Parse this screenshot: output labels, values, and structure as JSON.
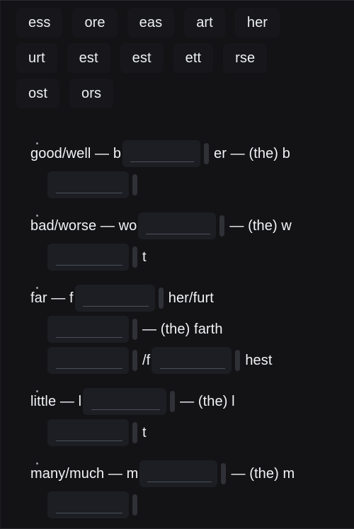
{
  "word_bank": {
    "rows": [
      [
        {
          "label": "ess"
        },
        {
          "label": "ore"
        },
        {
          "label": "eas"
        },
        {
          "label": "art"
        },
        {
          "label": "her"
        }
      ],
      [
        {
          "label": "urt"
        },
        {
          "label": "est"
        },
        {
          "label": "est"
        },
        {
          "label": "ett"
        },
        {
          "label": "rse"
        }
      ],
      [
        {
          "label": "ost"
        },
        {
          "label": "ors"
        }
      ]
    ]
  },
  "exercises": [
    {
      "lines": [
        {
          "indent": false,
          "parts": [
            {
              "kind": "text",
              "value": "good/well — b"
            },
            {
              "kind": "blank",
              "width": 110
            },
            {
              "kind": "caret"
            },
            {
              "kind": "text",
              "value": "er — (the) b"
            }
          ]
        },
        {
          "indent": true,
          "parts": [
            {
              "kind": "blank",
              "width": 115
            },
            {
              "kind": "caret"
            }
          ]
        }
      ]
    },
    {
      "lines": [
        {
          "indent": false,
          "parts": [
            {
              "kind": "text",
              "value": "bad/worse — wo"
            },
            {
              "kind": "blank",
              "width": 110
            },
            {
              "kind": "caret"
            },
            {
              "kind": "text",
              "value": "— (the) w"
            }
          ]
        },
        {
          "indent": true,
          "parts": [
            {
              "kind": "blank",
              "width": 115
            },
            {
              "kind": "caret"
            },
            {
              "kind": "text",
              "value": "t"
            }
          ]
        }
      ]
    },
    {
      "lines": [
        {
          "indent": false,
          "parts": [
            {
              "kind": "text",
              "value": "far — f"
            },
            {
              "kind": "blank",
              "width": 113
            },
            {
              "kind": "caret"
            },
            {
              "kind": "text",
              "value": "her/furt"
            }
          ]
        },
        {
          "indent": true,
          "parts": [
            {
              "kind": "blank",
              "width": 115
            },
            {
              "kind": "caret"
            },
            {
              "kind": "text",
              "value": "— (the) farth"
            }
          ]
        },
        {
          "indent": true,
          "parts": [
            {
              "kind": "blank",
              "width": 115
            },
            {
              "kind": "caret"
            },
            {
              "kind": "text",
              "value": "/f"
            },
            {
              "kind": "blank",
              "width": 113
            },
            {
              "kind": "caret"
            },
            {
              "kind": "text",
              "value": "hest"
            }
          ]
        }
      ]
    },
    {
      "lines": [
        {
          "indent": false,
          "parts": [
            {
              "kind": "text",
              "value": "little — l"
            },
            {
              "kind": "blank",
              "width": 118
            },
            {
              "kind": "caret"
            },
            {
              "kind": "text",
              "value": "— (the) l"
            }
          ]
        },
        {
          "indent": true,
          "parts": [
            {
              "kind": "blank",
              "width": 115
            },
            {
              "kind": "caret"
            },
            {
              "kind": "text",
              "value": "t"
            }
          ]
        }
      ]
    },
    {
      "lines": [
        {
          "indent": false,
          "parts": [
            {
              "kind": "text",
              "value": "many/much — m"
            },
            {
              "kind": "blank",
              "width": 110
            },
            {
              "kind": "caret"
            },
            {
              "kind": "text",
              "value": "— (the) m"
            }
          ]
        },
        {
          "indent": true,
          "parts": [
            {
              "kind": "blank",
              "width": 115
            },
            {
              "kind": "caret"
            }
          ]
        }
      ]
    }
  ],
  "colors": {
    "background": "#131316",
    "chip_bg": "#17171b",
    "dropzone_bg": "#1c1e23",
    "text": "#f1f3f5",
    "caret": "#2f3137",
    "rule": "#4c5059"
  }
}
